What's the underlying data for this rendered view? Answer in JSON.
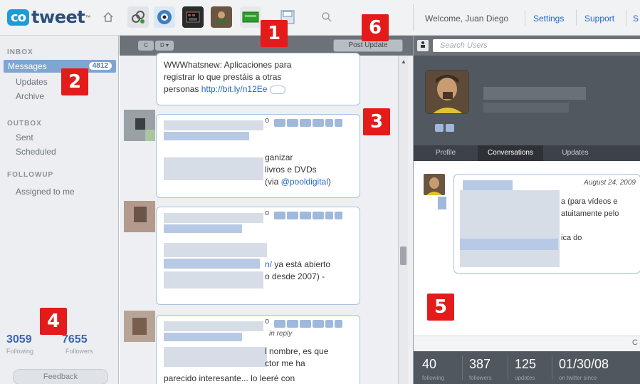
{
  "header": {
    "logo_badge": "co",
    "logo_text": "tweet",
    "logo_tm": "™",
    "welcome": "Welcome, Juan Diego",
    "settings": "Settings",
    "support": "Support",
    "sign_out_partial": "S",
    "icons": [
      "home-icon",
      "link-icon",
      "view-icon",
      "video-icon",
      "person-icon",
      "chart-icon",
      "save-icon",
      "search-icon"
    ]
  },
  "sidebar": {
    "inbox_title": "INBOX",
    "messages": "Messages",
    "messages_badge": "4812",
    "updates": "Updates",
    "archive": "Archive",
    "outbox_title": "OUTBOX",
    "sent": "Sent",
    "scheduled": "Scheduled",
    "followup_title": "FOLLOWUP",
    "assigned": "Assigned to me",
    "following_count": "3059",
    "following_label": "Following",
    "followers_count": "7655",
    "followers_label": "Followers",
    "feedback": "Feedback"
  },
  "stream": {
    "post_update": "Post Update",
    "tb_btn1": "C",
    "tb_btn2": "D ▾",
    "tweet0": {
      "line1": "WWWhatsnew: Aplicaciones para",
      "line2": "registrar lo que prestáis a otras",
      "line3_prefix": "personas",
      "link": "http://bit.ly/n12Ee"
    },
    "tweet1": {
      "line1": "ganizar",
      "line2": "livros e DVDs",
      "line3_prefix": "(via ",
      "mention": "@pooldigital",
      "line3_suffix": ")",
      "o": "o"
    },
    "tweet2": {
      "line1_link": "n/",
      "line1_rest": " ya está abierto",
      "line2": "o desde 2007) -",
      "o": "o"
    },
    "tweet3": {
      "meta": "in reply",
      "line1": "l nombre, es que",
      "line2": "ctor me ha",
      "line3": "parecido interesante... lo leeré con",
      "o": "o"
    }
  },
  "rpanel": {
    "search_placeholder": "Search Users",
    "tabs": [
      "Profile",
      "Conversations",
      "Updates"
    ],
    "convo_date": "August 24, 2009",
    "convo_line1": "a (para vídeos e",
    "convo_line2": "atuitamente pelo",
    "convo_line3": "ica do",
    "stats": [
      {
        "num": "40",
        "label": "following"
      },
      {
        "num": "387",
        "label": "followers"
      },
      {
        "num": "125",
        "label": "updates"
      },
      {
        "num": "01/30/08",
        "label": "on twitter since"
      }
    ],
    "footer_c": "C"
  },
  "callouts": [
    "1",
    "2",
    "3",
    "4",
    "5",
    "6"
  ],
  "colors": {
    "accent": "#1e9ad6",
    "link": "#1e69c7",
    "callout": "#e31b1b"
  }
}
